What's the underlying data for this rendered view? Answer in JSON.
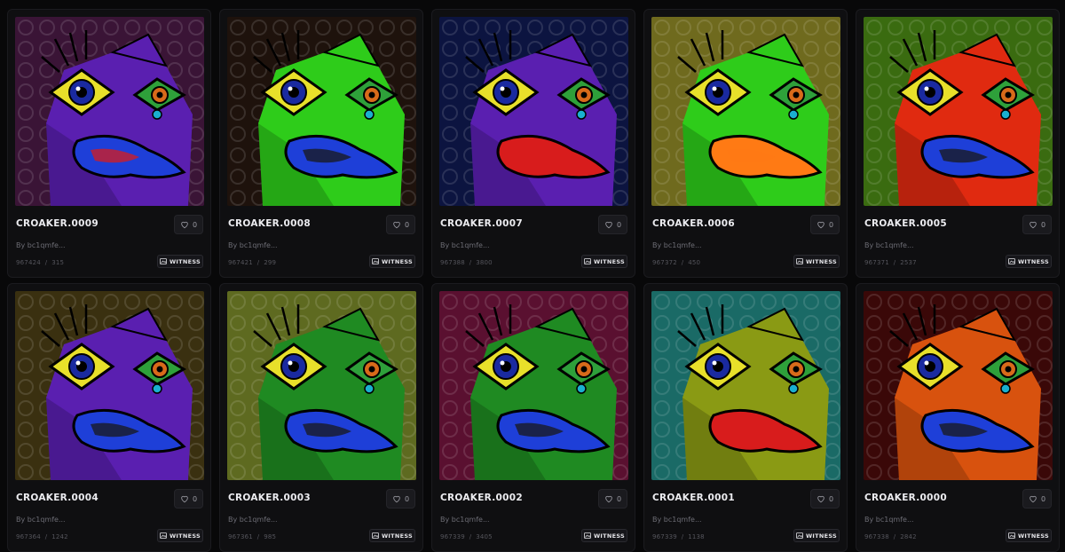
{
  "cards": [
    {
      "title": "CROAKER.0009",
      "likes": "0",
      "owner": "By bc1qmfe...",
      "inscription": "967424",
      "sep": "/",
      "number": "315",
      "witness": "WITNESS",
      "bg": "#3a1436",
      "skin": "#5a1fb0",
      "lips": "#d81c1c",
      "tongue": "#1e3fd8"
    },
    {
      "title": "CROAKER.0008",
      "likes": "0",
      "owner": "By bc1qmfe...",
      "inscription": "967421",
      "sep": "/",
      "number": "299",
      "witness": "WITNESS",
      "bg": "#1e120c",
      "skin": "#2ecc1a",
      "lips": "#1a1a1a",
      "tongue": "#1e3fd8"
    },
    {
      "title": "CROAKER.0007",
      "likes": "0",
      "owner": "By bc1qmfe...",
      "inscription": "967388",
      "sep": "/",
      "number": "3800",
      "witness": "WITNESS",
      "bg": "#0c1440",
      "skin": "#5a1fb0",
      "lips": "#d81c1c",
      "tongue": "#d81c1c"
    },
    {
      "title": "CROAKER.0006",
      "likes": "0",
      "owner": "By bc1qmfe...",
      "inscription": "967372",
      "sep": "/",
      "number": "450",
      "witness": "WITNESS",
      "bg": "#6f6a1e",
      "skin": "#2ecc1a",
      "lips": "#ff7a14",
      "tongue": "#ff7a14"
    },
    {
      "title": "CROAKER.0005",
      "likes": "0",
      "owner": "By bc1qmfe...",
      "inscription": "967371",
      "sep": "/",
      "number": "2537",
      "witness": "WITNESS",
      "bg": "#3a6b10",
      "skin": "#e02a10",
      "lips": "#1a1a1a",
      "tongue": "#1e3fd8"
    },
    {
      "title": "CROAKER.0004",
      "likes": "0",
      "owner": "By bc1qmfe...",
      "inscription": "967364",
      "sep": "/",
      "number": "1242",
      "witness": "WITNESS",
      "bg": "#3a3010",
      "skin": "#5a1fb0",
      "lips": "#1a1a1a",
      "tongue": "#1e3fd8"
    },
    {
      "title": "CROAKER.0003",
      "likes": "0",
      "owner": "By bc1qmfe...",
      "inscription": "967361",
      "sep": "/",
      "number": "985",
      "witness": "WITNESS",
      "bg": "#5e6a20",
      "skin": "#1f8a22",
      "lips": "#1a1a1a",
      "tongue": "#1e3fd8"
    },
    {
      "title": "CROAKER.0002",
      "likes": "0",
      "owner": "By bc1qmfe...",
      "inscription": "967339",
      "sep": "/",
      "number": "3405",
      "witness": "WITNESS",
      "bg": "#5a1030",
      "skin": "#1f8a22",
      "lips": "#1a1a1a",
      "tongue": "#1e3fd8"
    },
    {
      "title": "CROAKER.0001",
      "likes": "0",
      "owner": "By bc1qmfe...",
      "inscription": "967339",
      "sep": "/",
      "number": "1138",
      "witness": "WITNESS",
      "bg": "#1a6a66",
      "skin": "#8a9a14",
      "lips": "#d81c1c",
      "tongue": "#d81c1c"
    },
    {
      "title": "CROAKER.0000",
      "likes": "0",
      "owner": "By bc1qmfe...",
      "inscription": "967338",
      "sep": "/",
      "number": "2842",
      "witness": "WITNESS",
      "bg": "#3a0808",
      "skin": "#d8520e",
      "lips": "#1a1a1a",
      "tongue": "#1e3fd8"
    }
  ]
}
